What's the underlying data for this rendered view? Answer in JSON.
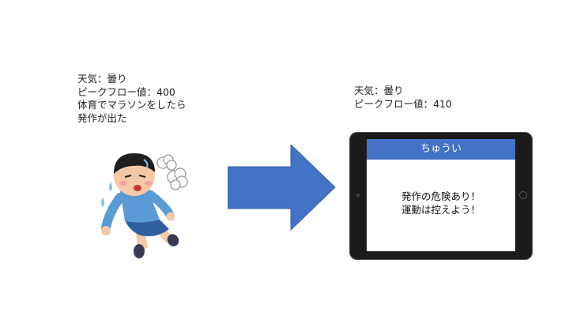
{
  "left_note": {
    "lines": [
      "天気：曇り",
      "ピークフロー値：400",
      "体育でマラソンをしたら",
      "発作が出た"
    ]
  },
  "right_note": {
    "lines": [
      "天気：曇り",
      "ピークフロー値：410"
    ]
  },
  "tablet": {
    "header": "ちゅうい",
    "message_lines": [
      "発作の危険あり！",
      "運動は控えよう！"
    ]
  },
  "colors": {
    "arrow": "#4472c4",
    "header": "#4472c4",
    "tablet_frame": "#1b1b1b"
  },
  "icons": {
    "figure": "collapsed-boy-illustration",
    "arrow": "right-arrow-icon"
  }
}
